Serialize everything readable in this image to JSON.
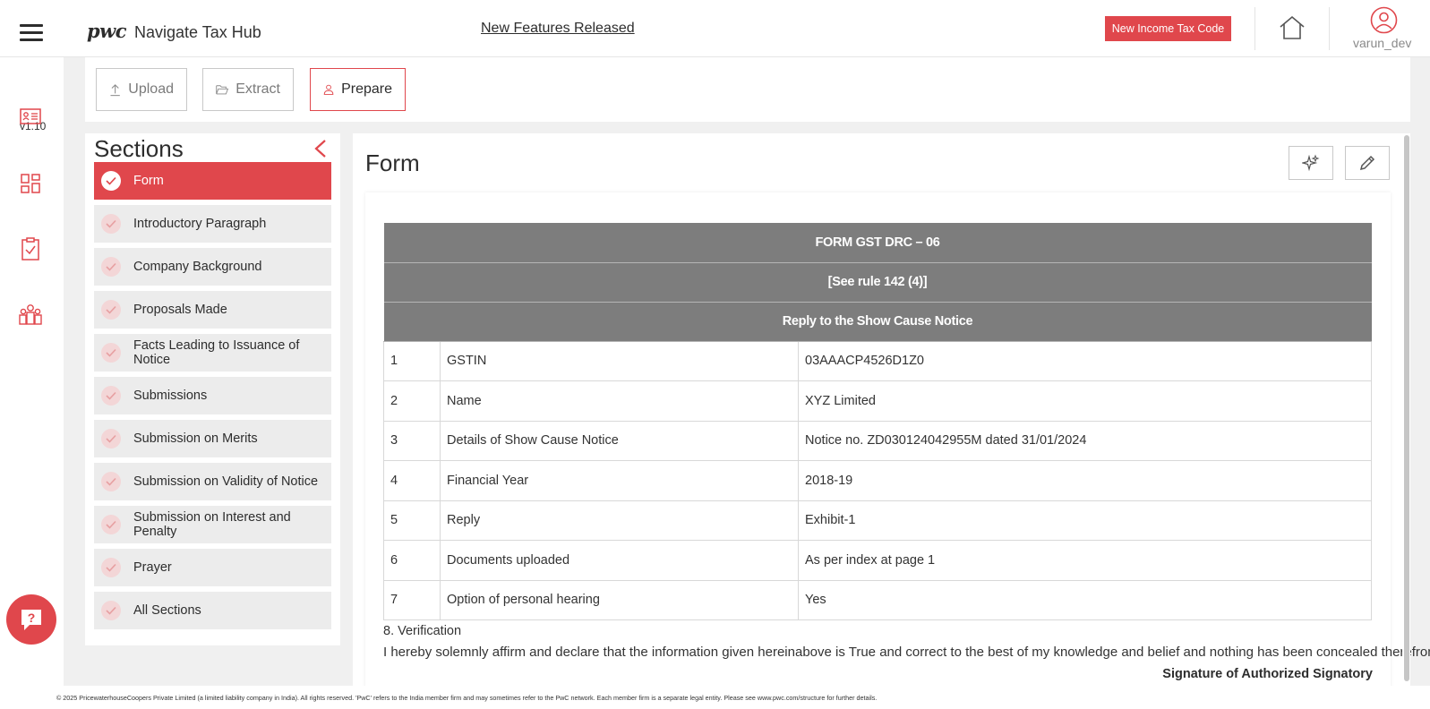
{
  "header": {
    "logo": "pwc",
    "app_name": "Navigate Tax Hub",
    "features_link": "New Features Released",
    "tax_code_button": "New Income Tax Code",
    "username": "varun_dev"
  },
  "rail": {
    "version": "v1.10",
    "icons": [
      "id-card-icon",
      "dashboard-grid-icon",
      "checklist-icon",
      "team-icon"
    ]
  },
  "toolbar": {
    "upload_label": "Upload",
    "extract_label": "Extract",
    "prepare_label": "Prepare",
    "active": "Prepare"
  },
  "sections": {
    "title": "Sections",
    "items": [
      {
        "label": "Form",
        "active": true
      },
      {
        "label": "Introductory Paragraph"
      },
      {
        "label": "Company Background"
      },
      {
        "label": "Proposals Made"
      },
      {
        "label": "Facts Leading to Issuance of Notice"
      },
      {
        "label": "Submissions"
      },
      {
        "label": "Submission on Merits"
      },
      {
        "label": "Submission on Validity of Notice"
      },
      {
        "label": "Submission on Interest and Penalty"
      },
      {
        "label": "Prayer"
      },
      {
        "label": "All Sections"
      }
    ]
  },
  "content": {
    "title": "Form",
    "header_rows": [
      "FORM GST DRC – 06",
      "[See rule 142 (4)]",
      "Reply to the Show Cause Notice"
    ],
    "rows": [
      {
        "num": "1",
        "field": "GSTIN",
        "value": "03AAACP4526D1Z0"
      },
      {
        "num": "2",
        "field": "Name",
        "value": "XYZ Limited"
      },
      {
        "num": "3",
        "field": "Details of Show Cause Notice",
        "value": "Notice no. ZD030124042955M dated 31/01/2024"
      },
      {
        "num": "4",
        "field": "Financial Year",
        "value": "2018-19"
      },
      {
        "num": "5",
        "field": "Reply",
        "value": "Exhibit-1"
      },
      {
        "num": "6",
        "field": "Documents uploaded",
        "value": "As per index at page 1"
      },
      {
        "num": "7",
        "field": "Option of personal hearing",
        "value": "Yes"
      }
    ],
    "verification_heading": "8. Verification",
    "declaration": "I hereby solemnly affirm and declare that the information given hereinabove is True and correct to the best of my knowledge and belief and nothing has been concealed therefrom.",
    "signature": "Signature of Authorized Signatory"
  },
  "footer": {
    "text": "© 2025 PricewaterhouseCoopers Private Limited (a limited liability company in India). All rights reserved. 'PwC' refers to the India member firm and may sometimes refer to the PwC network. Each member firm is a separate legal entity. Please see www.pwc.com/structure for further details."
  },
  "colors": {
    "accent": "#e0474c",
    "table_header": "#7d7d7d"
  }
}
